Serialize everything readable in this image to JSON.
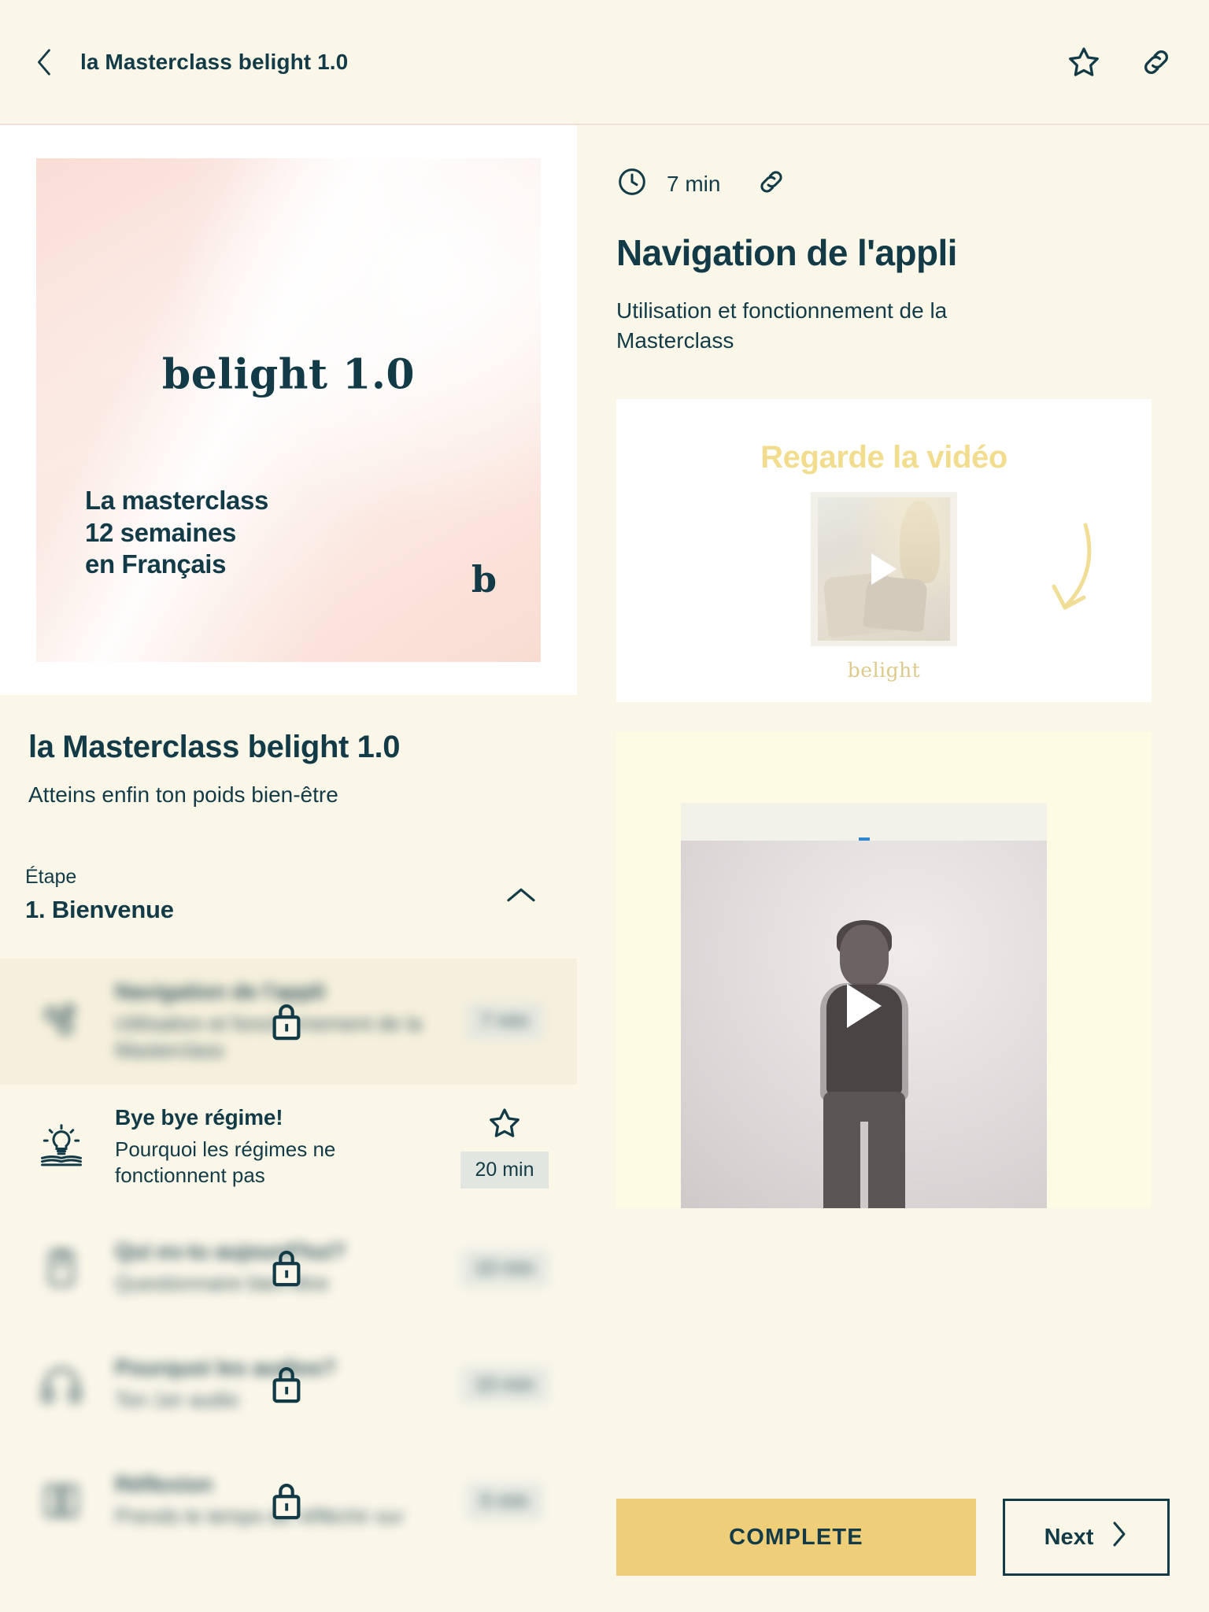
{
  "topbar": {
    "back_icon": "chevron-left-icon",
    "title": "la Masterclass belight 1.0",
    "star_icon": "star-icon",
    "link_icon": "link-icon"
  },
  "course": {
    "cover": {
      "logo": "belight 1.0",
      "tagline": "La masterclass\n12 semaines\nen Français",
      "tagline_lines": [
        "La masterclass",
        "12 semaines",
        "en Français"
      ],
      "brand_mark": "b"
    },
    "title": "la Masterclass belight 1.0",
    "subtitle": "Atteins enfin ton poids bien-être",
    "step_label": "Étape",
    "step_name": "1. Bienvenue",
    "collapse_icon": "chevron-up-icon"
  },
  "lessons": [
    {
      "icon": "app-navigation-icon",
      "title": "Navigation de l'appli",
      "desc": "Utilisation et fonctionnement de la Masterclass",
      "duration": "7 min",
      "locked": true,
      "blurred": true,
      "active": true,
      "starred": false
    },
    {
      "icon": "lightbulb-book-icon",
      "title": "Bye bye régime!",
      "desc": "Pourquoi les régimes ne fonctionnent pas",
      "duration": "20 min",
      "locked": false,
      "blurred": false,
      "active": false,
      "starred": true
    },
    {
      "icon": "clipboard-icon",
      "title": "Qui es-tu aujourd'hui?",
      "desc": "Questionnaire bien-être",
      "duration": "10 min",
      "locked": true,
      "blurred": true,
      "active": false,
      "starred": false
    },
    {
      "icon": "headphones-icon",
      "title": "Pourquoi les audios?",
      "desc": "Ton 1er audio",
      "duration": "10 min",
      "locked": true,
      "blurred": true,
      "active": false,
      "starred": false
    },
    {
      "icon": "journal-icon",
      "title": "Réflexion",
      "desc": "Prends le temps de réfléchir sur",
      "duration": "5 min",
      "locked": true,
      "blurred": true,
      "active": false,
      "starred": false
    }
  ],
  "lesson_detail": {
    "clock_icon": "clock-icon",
    "duration": "7 min",
    "link_icon": "link-icon",
    "title": "Navigation de l'appli",
    "description": "Utilisation et fonctionnement de la Masterclass"
  },
  "promo": {
    "heading": "Regarde la vidéo",
    "play_icon": "play-icon",
    "arrow_icon": "curved-arrow-icon",
    "brand": "belight"
  },
  "video": {
    "play_icon": "play-icon"
  },
  "actions": {
    "complete_label": "COMPLETE",
    "next_label": "Next",
    "next_icon": "chevron-right-icon"
  },
  "colors": {
    "page_bg": "#faf7e9",
    "ink": "#123b47",
    "accent_yellow": "#eece78",
    "promo_yellow": "#f2dd8f",
    "badge_gray": "#e2e6e0",
    "divider_pink": "#f2e0d8",
    "active_row": "#f5f0dd"
  }
}
